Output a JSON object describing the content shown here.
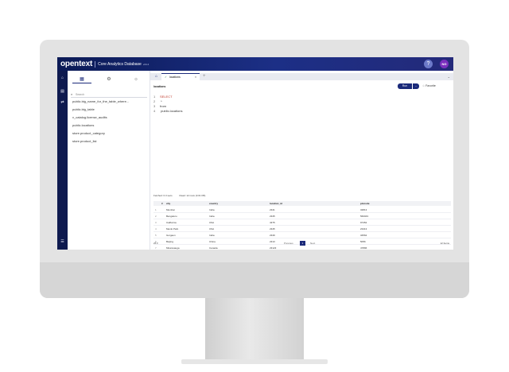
{
  "header": {
    "brand": "opentext",
    "product": "Core Analytics Database",
    "version": "v24.4",
    "help_icon": "?",
    "avatar": "NG"
  },
  "rail": {
    "icons": [
      "home-icon",
      "database-icon",
      "flow-icon",
      "list-icon"
    ]
  },
  "explorer": {
    "tab_icons": [
      "table-icon",
      "settings-icon",
      "bulb-icon"
    ],
    "search_placeholder": "Search",
    "items": [
      "public.big_name_for_the_table_where...",
      "public.big_table",
      "v_catalog.license_audits",
      "public.locations",
      "store.product_category",
      "store.product_list"
    ]
  },
  "tabs": {
    "active": "locations"
  },
  "editor": {
    "title": "locations",
    "run_label": "Run",
    "favorite_label": "Favorite",
    "lines": [
      {
        "n": "1",
        "text": "SELECT",
        "kw": true
      },
      {
        "n": "2",
        "text": "  *",
        "kw": false
      },
      {
        "n": "3",
        "text": "from",
        "kw": false
      },
      {
        "n": "4",
        "text": "  public.locations",
        "kw": false
      }
    ]
  },
  "results": {
    "fetch_time": "Fetched: 0.3 secs",
    "row_count": "Read: 12 rows (0.01 KB)",
    "columns": [
      "#",
      "city",
      "country",
      "location_id",
      "pincode"
    ],
    "rows": [
      [
        "1",
        "Mumbai",
        "India",
        "2341",
        "34813"
      ],
      [
        "2",
        "Bengaluru",
        "India",
        "2345",
        "560043"
      ],
      [
        "3",
        "California",
        "USA",
        "4375",
        "97452"
      ],
      [
        "4",
        "Menlo Park",
        "USA",
        "2345",
        "23413"
      ],
      [
        "5",
        "Gurgaon",
        "India",
        "2349",
        "34562"
      ],
      [
        "6",
        "Beijing",
        "China",
        "2313",
        "5056"
      ],
      [
        "7",
        "Mississauga",
        "Canada",
        "23123",
        "47896"
      ],
      [
        "8",
        "Waterloo",
        "Canada",
        "8843",
        "12945"
      ],
      [
        "9",
        "Havana",
        "Central America",
        "3647",
        "1657"
      ],
      [
        "10",
        "Hyderabad",
        "India",
        "4783",
        "23456"
      ],
      [
        "11",
        "Chennai",
        "India",
        "4432",
        "45567"
      ],
      [
        "12",
        "Ottawa",
        "Canada",
        "4321",
        "45678"
      ]
    ],
    "pager": {
      "page_size": "25",
      "prev": "Previous",
      "page": "1",
      "next": "Next",
      "items": "12 Items"
    }
  }
}
